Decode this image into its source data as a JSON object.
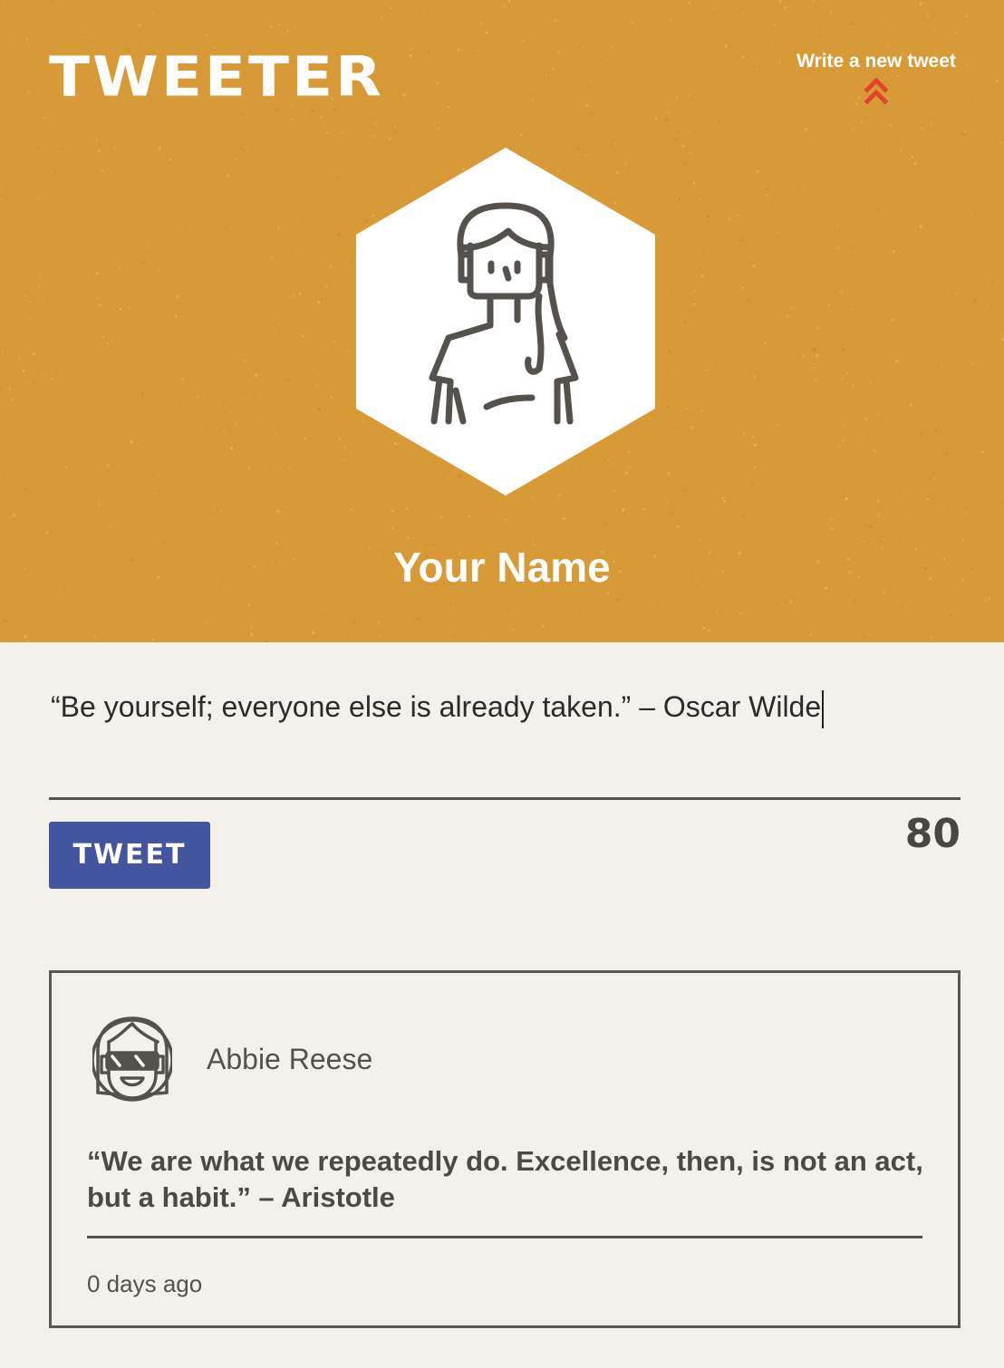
{
  "app": {
    "logo_text": "TWEETER"
  },
  "header": {
    "compose_link_label": "Write a new tweet",
    "compose_icon": "double-chevron-up-icon",
    "avatar_icon": "woman-avatar-icon",
    "profile_name": "Your Name"
  },
  "composer": {
    "input_value": "“Be yourself; everyone else is already taken.” – Oscar Wilde",
    "button_label": "TWEET",
    "char_count": "80"
  },
  "tweets": [
    {
      "author": "Abbie Reese",
      "avatar_icon": "girl-glasses-avatar-icon",
      "text": "“We are what we repeatedly do. Excellence, then, is not an act, but a habit.” – Aristotle",
      "time": "0 days ago"
    }
  ],
  "colors": {
    "header_bg": "#d89a36",
    "page_bg": "#f4f1ed",
    "button_bg": "#4455a0",
    "accent_red": "#e0452b",
    "ink": "#55524d"
  }
}
